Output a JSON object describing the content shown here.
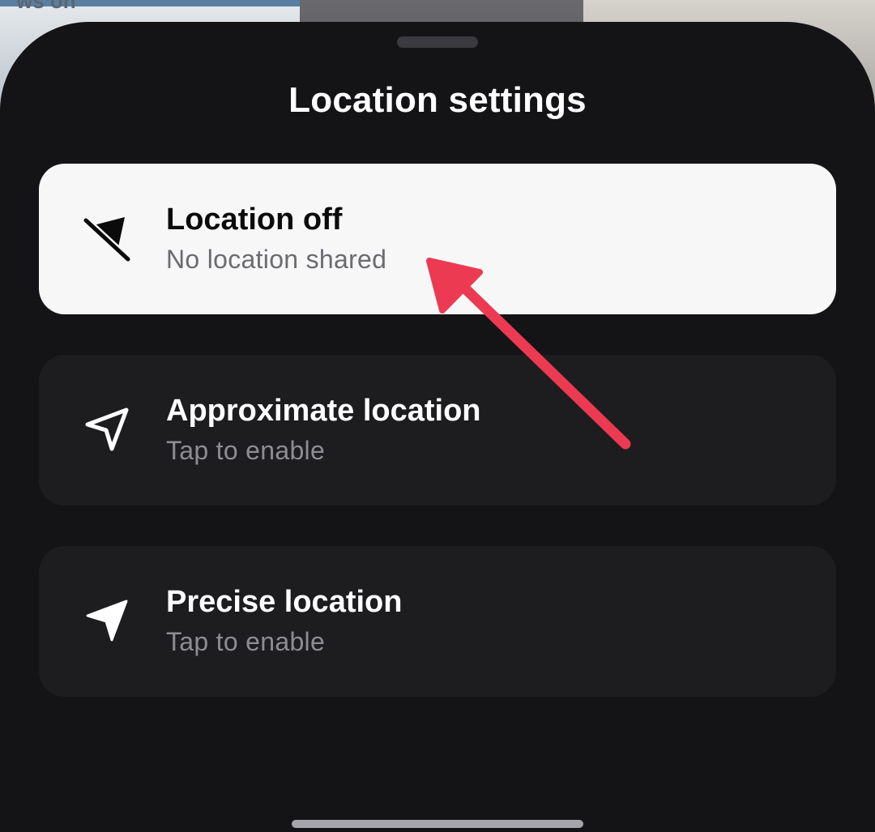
{
  "background": {
    "partial_text": "ws on"
  },
  "sheet": {
    "title": "Location settings"
  },
  "options": [
    {
      "label": "Location off",
      "sublabel": "No location shared",
      "icon": "location-off-icon",
      "selected": true
    },
    {
      "label": "Approximate location",
      "sublabel": "Tap to enable",
      "icon": "navigation-outline-icon",
      "selected": false
    },
    {
      "label": "Precise location",
      "sublabel": "Tap to enable",
      "icon": "navigation-filled-icon",
      "selected": false
    }
  ],
  "colors": {
    "sheet_bg": "#141416",
    "selected_bg": "#f7f7f8",
    "option_bg": "#1d1d20",
    "annotation_arrow": "#ec3a52"
  }
}
